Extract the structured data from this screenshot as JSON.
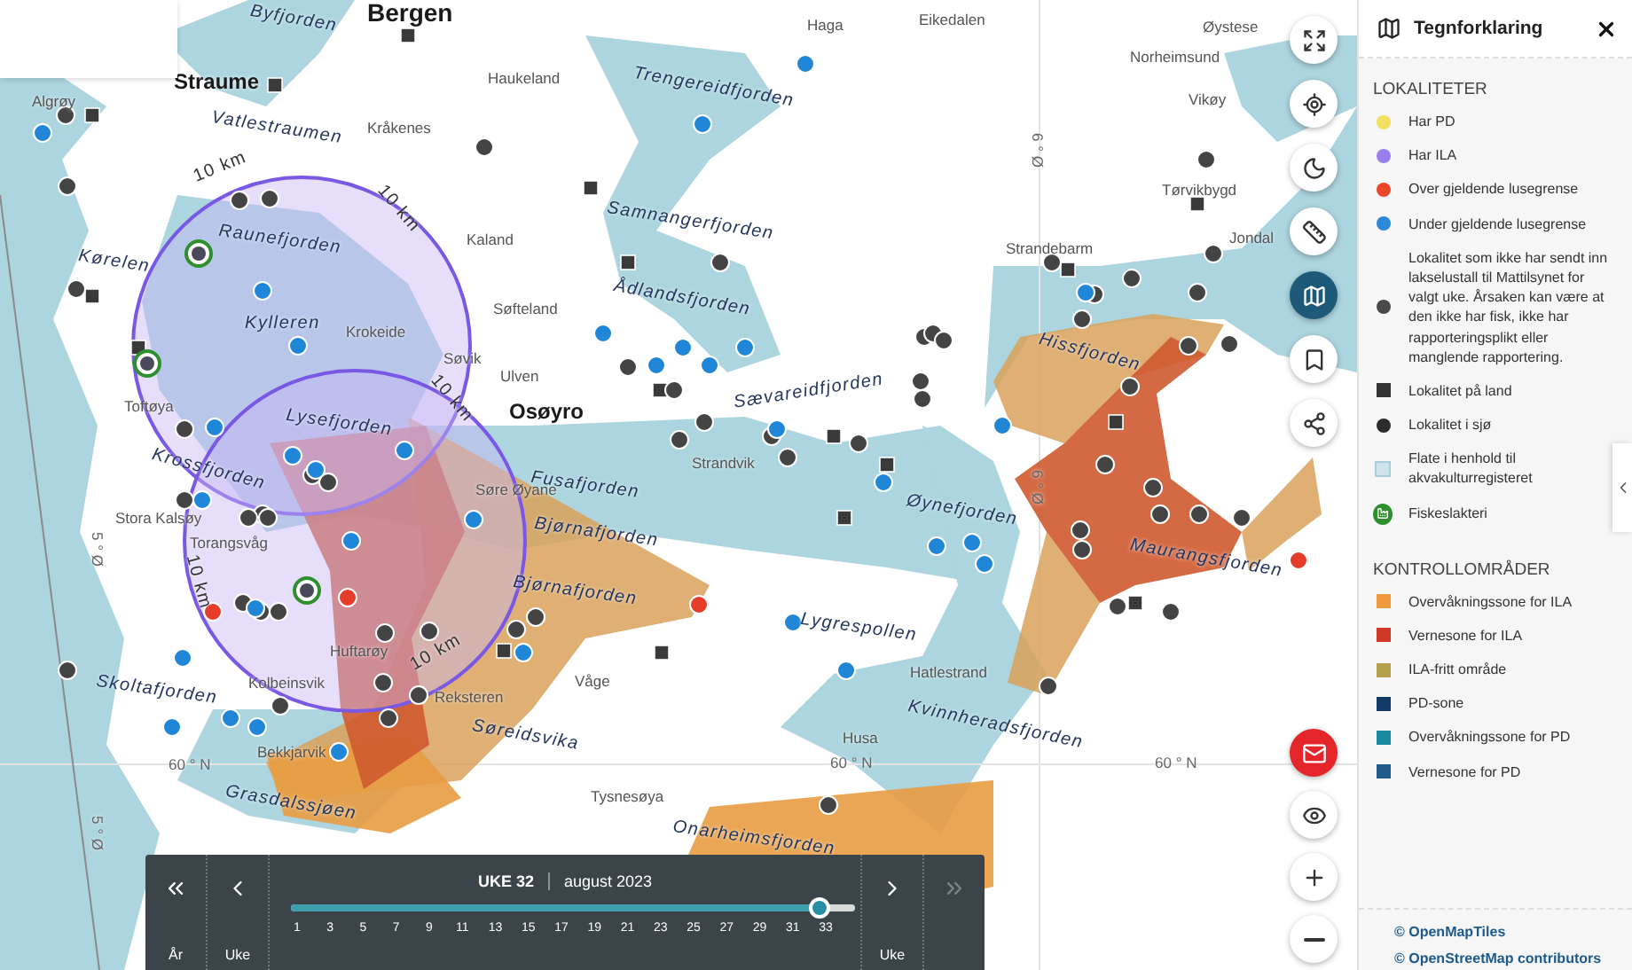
{
  "map": {
    "labels": [
      {
        "text": "Byfjorden",
        "kind": "water"
      },
      {
        "text": "Bergen",
        "kind": "city"
      },
      {
        "text": "Haga",
        "kind": "place"
      },
      {
        "text": "Eikedalen",
        "kind": "place"
      },
      {
        "text": "Øystese",
        "kind": "place"
      },
      {
        "text": "Straume",
        "kind": "town"
      },
      {
        "text": "Haukeland",
        "kind": "place"
      },
      {
        "text": "Trengereidfjorden",
        "kind": "water"
      },
      {
        "text": "Norheimsund",
        "kind": "place"
      },
      {
        "text": "Algrøy",
        "kind": "place"
      },
      {
        "text": "Vikøy",
        "kind": "place"
      },
      {
        "text": "Vatlestraumen",
        "kind": "water"
      },
      {
        "text": "Kråkenes",
        "kind": "place"
      },
      {
        "text": "6 ° Ø",
        "kind": "grid"
      },
      {
        "text": "10 km",
        "kind": "distance"
      },
      {
        "text": "10 km",
        "kind": "distance"
      },
      {
        "text": "Tørvikbygd",
        "kind": "place"
      },
      {
        "text": "Samnangerfjorden",
        "kind": "water"
      },
      {
        "text": "Kaland",
        "kind": "place"
      },
      {
        "text": "Jondal",
        "kind": "place"
      },
      {
        "text": "Raunefjorden",
        "kind": "water"
      },
      {
        "text": "Strandebarm",
        "kind": "place"
      },
      {
        "text": "Kørelen",
        "kind": "water"
      },
      {
        "text": "Ådlandsfjorden",
        "kind": "water"
      },
      {
        "text": "Søfteland",
        "kind": "place"
      },
      {
        "text": "Kylleren",
        "kind": "water"
      },
      {
        "text": "Krokeide",
        "kind": "place"
      },
      {
        "text": "Hissfjorden",
        "kind": "water"
      },
      {
        "text": "Søvik",
        "kind": "place"
      },
      {
        "text": "Ulven",
        "kind": "place"
      },
      {
        "text": "10 km",
        "kind": "distance"
      },
      {
        "text": "Toftøya",
        "kind": "place"
      },
      {
        "text": "Osøyro",
        "kind": "town"
      },
      {
        "text": "Sævareidfjorden",
        "kind": "water"
      },
      {
        "text": "Lysefjorden",
        "kind": "water"
      },
      {
        "text": "Krossfjorden",
        "kind": "water"
      },
      {
        "text": "Strandvik",
        "kind": "place"
      },
      {
        "text": "Fusafjorden",
        "kind": "water"
      },
      {
        "text": "Søre Øyane",
        "kind": "place"
      },
      {
        "text": "Øynefjorden",
        "kind": "water"
      },
      {
        "text": "6 ° Ø",
        "kind": "grid"
      },
      {
        "text": "Stora Kalsøy",
        "kind": "place"
      },
      {
        "text": "Bjørnafjorden",
        "kind": "water"
      },
      {
        "text": "5 ° Ø",
        "kind": "grid"
      },
      {
        "text": "Torangsvåg",
        "kind": "place"
      },
      {
        "text": "Maurangsfjorden",
        "kind": "water"
      },
      {
        "text": "10 km",
        "kind": "distance"
      },
      {
        "text": "Bjørnafjorden",
        "kind": "water"
      },
      {
        "text": "Lygrespollen",
        "kind": "water"
      },
      {
        "text": "Huftarøy",
        "kind": "place"
      },
      {
        "text": "Hatlestrand",
        "kind": "place"
      },
      {
        "text": "Våge",
        "kind": "place"
      },
      {
        "text": "Kolbeinsvik",
        "kind": "place"
      },
      {
        "text": "Skoltafjorden",
        "kind": "water"
      },
      {
        "text": "10 km",
        "kind": "distance"
      },
      {
        "text": "Reksteren",
        "kind": "place"
      },
      {
        "text": "Kvinnheradsfjorden",
        "kind": "water"
      },
      {
        "text": "Søreidsvika",
        "kind": "water"
      },
      {
        "text": "Husa",
        "kind": "place"
      },
      {
        "text": "Bekkjarvik",
        "kind": "place"
      },
      {
        "text": "60 ° N",
        "kind": "grid"
      },
      {
        "text": "60 ° N",
        "kind": "grid"
      },
      {
        "text": "60 ° N",
        "kind": "grid"
      },
      {
        "text": "Grasdalssjøen",
        "kind": "water"
      },
      {
        "text": "Tysnesøya",
        "kind": "place"
      },
      {
        "text": "5 ° Ø",
        "kind": "grid"
      },
      {
        "text": "Onarheimsfjorden",
        "kind": "water"
      }
    ]
  },
  "toolbar": {
    "top": [
      {
        "kind": "fullscreen",
        "selected": false
      },
      {
        "kind": "locate",
        "selected": false
      },
      {
        "kind": "theme",
        "selected": false
      },
      {
        "kind": "measure",
        "selected": false
      },
      {
        "kind": "legend",
        "selected": true
      },
      {
        "kind": "bookmark",
        "selected": false
      },
      {
        "kind": "share",
        "selected": false
      }
    ],
    "bottom": [
      {
        "kind": "mail"
      },
      {
        "kind": "visibility"
      },
      {
        "kind": "zoom_in"
      },
      {
        "kind": "zoom_out"
      }
    ]
  },
  "timeline": {
    "previous_year": {
      "label": "År",
      "disabled": false
    },
    "previous_week": {
      "label": "Uke",
      "disabled": false
    },
    "week": "UKE 32",
    "month": "august 2023",
    "level": 0.94,
    "ticks": [
      "1",
      "3",
      "5",
      "7",
      "9",
      "11",
      "13",
      "15",
      "17",
      "19",
      "21",
      "23",
      "25",
      "27",
      "29",
      "31",
      "33"
    ],
    "next_week": {
      "label": "Uke",
      "disabled": false
    },
    "next_year": {
      "disabled": true
    }
  },
  "legend": {
    "title": "Tegnforklaring",
    "sections": [
      {
        "heading": "LOKALITETER",
        "items": [
          {
            "kind": "dot",
            "color": "#f2e15e",
            "label": "Har PD"
          },
          {
            "kind": "dot",
            "color": "#9a7ef0",
            "label": "Har ILA"
          },
          {
            "kind": "dot",
            "color": "#e8472b",
            "label": "Over gjeldende lusegrense"
          },
          {
            "kind": "dot",
            "color": "#2a8ad8",
            "label": "Under gjeldende lusegrense"
          },
          {
            "kind": "dot",
            "color": "#4a4a4a",
            "label": "Lokalitet som ikke har sendt inn lakselustall til Mattilsynet for valgt uke. Årsaken kan være at den ikke har fisk, ikke har rapporteringsplikt eller manglende rapportering."
          },
          {
            "kind": "square",
            "color": "#333333",
            "label": "Lokalitet på land"
          },
          {
            "kind": "dot",
            "color": "#2b2b2b",
            "label": "Lokalitet i sjø"
          },
          {
            "kind": "area",
            "color": "#cfe5ee",
            "label": "Flate i henhold til akvakulturregisteret"
          },
          {
            "kind": "slaughterhouse",
            "color": "#2f8f2f",
            "label": "Fiskeslakteri"
          }
        ]
      },
      {
        "heading": "KONTROLLOMRÅDER",
        "items": [
          {
            "kind": "square",
            "color": "#f09a3e",
            "label": "Overvåkningssone for ILA"
          },
          {
            "kind": "square",
            "color": "#d03a26",
            "label": "Vernesone for ILA"
          },
          {
            "kind": "square",
            "color": "#b3a24a",
            "label": "ILA-fritt område"
          },
          {
            "kind": "square",
            "color": "#123a66",
            "label": "PD-sone"
          },
          {
            "kind": "square",
            "color": "#1b8aa0",
            "label": "Overvåkningssone for PD"
          },
          {
            "kind": "square",
            "color": "#1d5a8a",
            "label": "Vernesone for PD"
          }
        ]
      }
    ],
    "credits": [
      "© OpenMapTiles",
      "© OpenStreetMap contributors"
    ]
  }
}
